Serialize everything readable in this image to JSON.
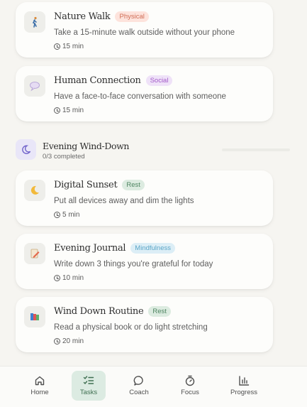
{
  "tasks_top": [
    {
      "title": "Nature Walk",
      "tag": "Physical",
      "desc": "Take a 15-minute walk outside without your phone",
      "duration": "15 min",
      "icon": "walking-person-icon"
    },
    {
      "title": "Human Connection",
      "tag": "Social",
      "desc": "Have a face-to-face conversation with someone",
      "duration": "15 min",
      "icon": "speech-bubble-icon"
    }
  ],
  "section": {
    "title": "Evening Wind-Down",
    "subtitle": "0/3 completed",
    "icon": "moon-icon",
    "progress": 0
  },
  "tasks_evening": [
    {
      "title": "Digital Sunset",
      "tag": "Rest",
      "desc": "Put all devices away and dim the lights",
      "duration": "5 min",
      "icon": "crescent-moon-icon"
    },
    {
      "title": "Evening Journal",
      "tag": "Mindfulness",
      "desc": "Write down 3 things you're grateful for today",
      "duration": "10 min",
      "icon": "journal-pencil-icon"
    },
    {
      "title": "Wind Down Routine",
      "tag": "Rest",
      "desc": "Read a physical book or do light stretching",
      "duration": "20 min",
      "icon": "books-icon"
    }
  ],
  "nav": [
    {
      "label": "Home",
      "icon": "home-icon"
    },
    {
      "label": "Tasks",
      "icon": "tasks-icon",
      "active": true
    },
    {
      "label": "Coach",
      "icon": "chat-bubble-icon"
    },
    {
      "label": "Focus",
      "icon": "timer-icon"
    },
    {
      "label": "Progress",
      "icon": "bar-chart-icon"
    }
  ],
  "colors": {
    "physical_tag": "#d06e57",
    "social_tag": "#a35bc9",
    "rest_tag": "#4d8460",
    "mindfulness_tag": "#5ca6c7",
    "active_nav": "#dcebe2"
  }
}
